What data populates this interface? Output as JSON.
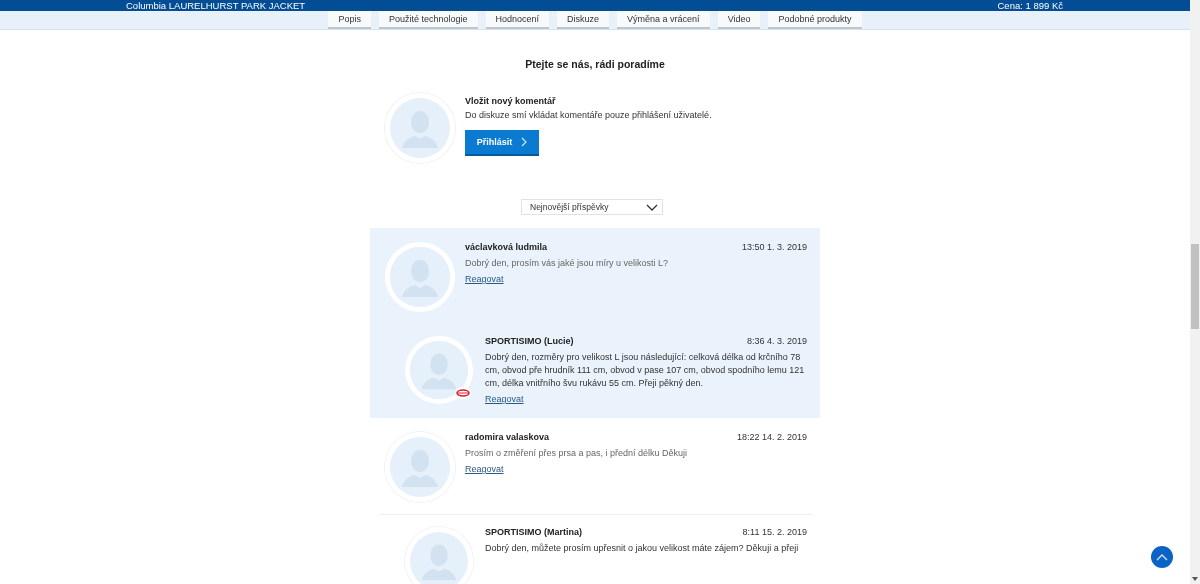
{
  "header": {
    "product_title": "Columbia LAURELHURST PARK JACKET",
    "price": "Cena: 1 899 Kč"
  },
  "tabs": [
    {
      "label": "Popis",
      "selected": false
    },
    {
      "label": "Použité technologie",
      "selected": false
    },
    {
      "label": "Hodnocení",
      "selected": false
    },
    {
      "label": "Diskuze",
      "selected": false
    },
    {
      "label": "Výměna a vrácení",
      "selected": false
    },
    {
      "label": "Video",
      "selected": false
    },
    {
      "label": "Podobné produkty",
      "selected": false
    }
  ],
  "discussion": {
    "title": "Ptejte se nás, rádi poradíme",
    "new_comment": {
      "title": "Vložit nový komentář",
      "note": "Do diskuze smí vkládat komentáře pouze přihlášení uživatelé.",
      "button": "Přihlásit"
    },
    "sort": {
      "value": "Nejnovější příspěvky"
    },
    "threads": [
      {
        "highlighted": true,
        "author": "václavková ludmila",
        "time": "13:50 1. 3. 2019",
        "text": "Dobrý den, prosím vás jaké jsou míry u velikosti L?",
        "reply_link": "Reagovat",
        "staff_badge": false,
        "replies": [
          {
            "author": "SPORTISIMO (Lucie)",
            "time": "8:36 4. 3. 2019",
            "text": "Dobrý den, rozměry pro velikost L jsou následující: celková délka od krčního 78 cm, obvod pře hrudník 111 cm, obvod v pase 107 cm, obvod spodního lemu 121 cm, délka vnitřního švu rukávu 55 cm. Přeji pěkný den.",
            "reply_link": "Reagovat",
            "staff_badge": true
          }
        ]
      },
      {
        "highlighted": false,
        "author": "radomira valaskova",
        "time": "18:22 14. 2. 2019",
        "text": "Prosím o změření přes prsa a pas, i přední délku Děkuji",
        "reply_link": "Reagovat",
        "staff_badge": false,
        "replies": [
          {
            "author": "SPORTISIMO (Martina)",
            "time": "8:11 15. 2. 2019",
            "text": "Dobrý den, můžete prosím upřesnit o jakou velikost máte zájem? Děkuji a přeji",
            "staff_badge": false
          }
        ]
      }
    ]
  }
}
